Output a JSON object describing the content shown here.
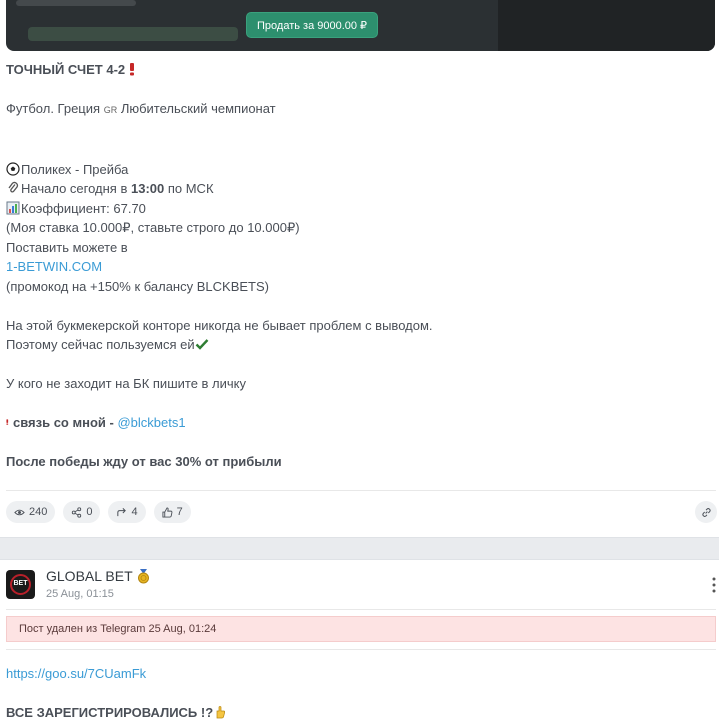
{
  "banner": {
    "sell_label": "Продать за 9000.00 ₽"
  },
  "post": {
    "headline": "ТОЧНЫЙ СЧЕТ 4-2",
    "league": "Футбол. Греция",
    "league_flag": "GR",
    "league_suffix": "Любительский чемпионат",
    "match": "Поликех - Прейба",
    "start_prefix": "Начало сегодня в ",
    "start_time": "13:00",
    "start_suffix": " по МСК",
    "coef": "Коэффициент: 67.70",
    "stake": "(Моя ставка 10.000₽, ставьте строго до 10.000₽)",
    "place_text": "Поставить можете в",
    "bk_link": "1-BETWIN.COM",
    "promo": "(промокод на +150% к балансу BLCKBETS)",
    "no_problems": "На этой букмекерской конторе никогда не бывает проблем с выводом.",
    "use_now": "Поэтому сейчас пользуемся ей",
    "no_access": "У кого не заходит на БК пишите в личку",
    "contact_label": "связь со мной - ",
    "contact_handle": "@blckbets1",
    "after_win": "После победы жду от вас 30% от прибыли"
  },
  "stats": {
    "views": "240",
    "shares": "0",
    "forwards": "4",
    "likes": "7"
  },
  "channel": {
    "name": "GLOBAL BET",
    "time": "25 Aug, 01:15",
    "avatar_text": "BET"
  },
  "deleted_notice": {
    "text": "Пост удален из Telegram ",
    "time": "25 Aug, 01:24"
  },
  "post2": {
    "link": "https://goo.su/7CUamFk",
    "caps": "ВСЕ ЗАРЕГИСТРИРОВАЛИСЬ !?"
  },
  "colors": {
    "accent_link": "#3a9bd5",
    "sell_button": "#2d8f6e",
    "deleted_bg": "#fde3e3"
  },
  "icons": [
    "soccer-ball-icon",
    "paperclip-icon",
    "chart-icon",
    "check-icon",
    "exclamation-icon",
    "eye-icon",
    "share-icon",
    "forward-icon",
    "thumbs-up-icon",
    "link-icon",
    "medal-icon",
    "more-vertical-icon",
    "hand-icon"
  ]
}
